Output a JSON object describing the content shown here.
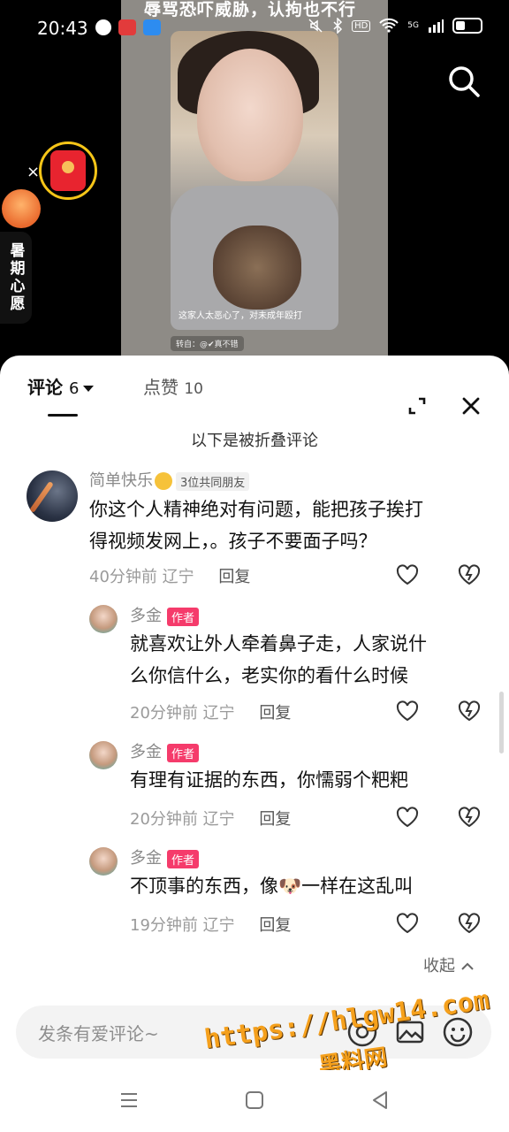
{
  "status": {
    "time": "20:43",
    "signal_label": "5G",
    "hd_label": "HD"
  },
  "video": {
    "title": "辱骂恐吓威胁，认拘也不行",
    "caption": "这家人太恶心了，对未成年殴打",
    "repost": "转自：@✔真不错"
  },
  "widget": {
    "wish_label": "暑期心愿",
    "close_glyph": "×"
  },
  "tabs": {
    "comments_label": "评论",
    "comments_count": "6",
    "likes_label": "点赞",
    "likes_count": "10"
  },
  "folded_note": "以下是被折叠评论",
  "comments": [
    {
      "username": "简单快乐",
      "badge": "3位共同朋友",
      "line1": "你这个人精神绝对有问题，能把孩子挨打",
      "line2": "得视频发网上，。孩子不要面子吗？",
      "time": "40分钟前",
      "location": "辽宁",
      "reply": "回复"
    },
    {
      "username": "多金",
      "badge": "作者",
      "line1": "就喜欢让外人牵着鼻子走，人家说什",
      "line2": "么你信什么，老实你的看什么时候",
      "time": "20分钟前",
      "location": "辽宁",
      "reply": "回复"
    },
    {
      "username": "多金",
      "badge": "作者",
      "line1": "有理有证据的东西，你懦弱个粑粑",
      "time": "20分钟前",
      "location": "辽宁",
      "reply": "回复"
    },
    {
      "username": "多金",
      "badge": "作者",
      "line1a": "不顶事的东西，像",
      "line1_emoji": "🐶",
      "line1b": "一样在这乱叫",
      "time": "19分钟前",
      "location": "辽宁",
      "reply": "回复"
    }
  ],
  "collapse_label": "收起",
  "input": {
    "placeholder": "发条有爱评论~"
  },
  "watermark": {
    "url": "https://hlgw14.com",
    "name": "黑料网"
  },
  "colors": {
    "author_badge": "#f53b6b",
    "ring": "#f5c518",
    "envelope": "#e8242f"
  },
  "icons": [
    "search-icon",
    "close-icon",
    "expand-icon",
    "heart-icon",
    "dislike-icon",
    "at-icon",
    "image-icon",
    "emoji-icon",
    "menu-icon",
    "home-icon",
    "back-icon"
  ]
}
